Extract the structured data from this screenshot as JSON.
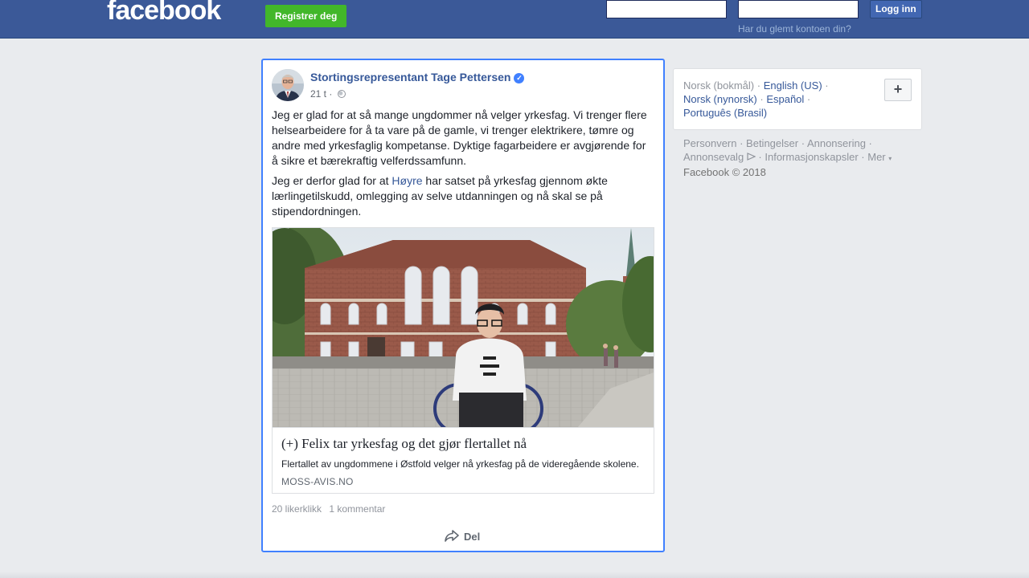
{
  "header": {
    "logo": "facebook",
    "register_label": "Registrer deg",
    "email_value": "",
    "password_value": "",
    "login_label": "Logg inn",
    "forgot_label": "Har du glemt kontoen din?"
  },
  "post": {
    "author": "Stortingsrepresentant Tage Pettersen",
    "time": "21 t",
    "separator": "·",
    "paragraph1": "Jeg er glad for at så mange ungdommer nå velger yrkesfag. Vi trenger flere helsearbeidere for å ta vare på de gamle, vi trenger elektrikere, tømre og andre med yrkesfaglig kompetanse. Dyktige fagarbeidere er avgjørende for å sikre et bærekraftig velferdssamfunn.",
    "paragraph2_before": "Jeg er derfor glad for at ",
    "paragraph2_link": "Høyre",
    "paragraph2_after": " har satset på yrkesfag gjennom økte lærlingetilskudd, omlegging av selve utdanningen og nå skal se på stipendordningen.",
    "link": {
      "title": "(+) Felix tar yrkesfag og det gjør flertallet nå",
      "description": "Flertallet av ungdommene i Østfold velger nå yrkesfag på de videregående skolene.",
      "domain": "MOSS-AVIS.NO"
    },
    "likes": "20 likerklikk",
    "comments": "1 kommentar",
    "share_label": "Del"
  },
  "languages": {
    "current": "Norsk (bokmål)",
    "options": [
      "English (US)",
      "Norsk (nynorsk)",
      "Español",
      "Português (Brasil)"
    ],
    "add_label": "+"
  },
  "footer": {
    "links": [
      "Personvern",
      "Betingelser",
      "Annonsering",
      "Annonsevalg",
      "Informasjonskapsler",
      "Mer"
    ],
    "copyright": "Facebook © 2018"
  },
  "colors": {
    "brand": "#3b5998",
    "register_green": "#42b72a",
    "link_blue": "#365899",
    "focus_border": "#4080ff"
  }
}
